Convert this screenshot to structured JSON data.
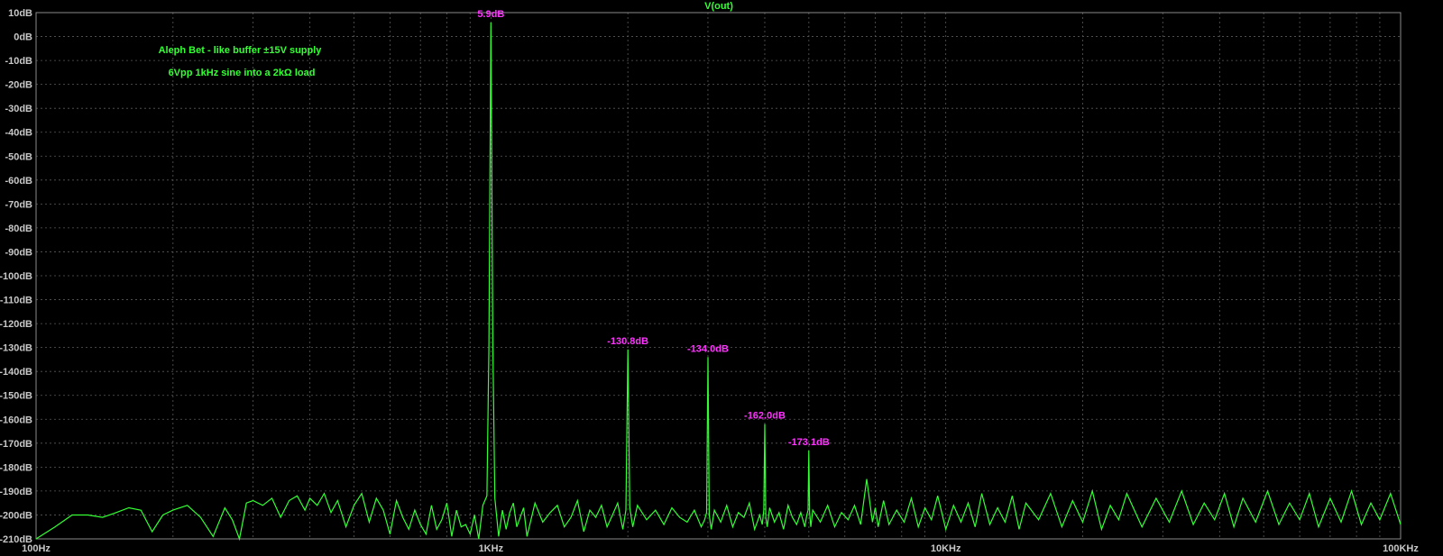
{
  "trace_color": "#33ff33",
  "label_color": "#ff33ff",
  "grid_color": "#5a5a5a",
  "chart_data": {
    "type": "line",
    "title": "V(out)",
    "annotations": [
      "Aleph Bet - like buffer ±15V supply",
      "6Vpp 1kHz sine into a 2kΩ load"
    ],
    "x_scale": "log",
    "xlim": [
      100,
      100000
    ],
    "ylim": [
      -210,
      10
    ],
    "grid": true,
    "xticks": [
      {
        "value": 100,
        "label": "100Hz"
      },
      {
        "value": 1000,
        "label": "1KHz"
      },
      {
        "value": 10000,
        "label": "10KHz"
      },
      {
        "value": 100000,
        "label": "100KHz"
      }
    ],
    "yticks": [
      {
        "value": 10,
        "label": "10dB"
      },
      {
        "value": 0,
        "label": "0dB"
      },
      {
        "value": -10,
        "label": "-10dB"
      },
      {
        "value": -20,
        "label": "-20dB"
      },
      {
        "value": -30,
        "label": "-30dB"
      },
      {
        "value": -40,
        "label": "-40dB"
      },
      {
        "value": -50,
        "label": "-50dB"
      },
      {
        "value": -60,
        "label": "-60dB"
      },
      {
        "value": -70,
        "label": "-70dB"
      },
      {
        "value": -80,
        "label": "-80dB"
      },
      {
        "value": -90,
        "label": "-90dB"
      },
      {
        "value": -100,
        "label": "-100dB"
      },
      {
        "value": -110,
        "label": "-110dB"
      },
      {
        "value": -120,
        "label": "-120dB"
      },
      {
        "value": -130,
        "label": "-130dB"
      },
      {
        "value": -140,
        "label": "-140dB"
      },
      {
        "value": -150,
        "label": "-150dB"
      },
      {
        "value": -160,
        "label": "-160dB"
      },
      {
        "value": -170,
        "label": "-170dB"
      },
      {
        "value": -180,
        "label": "-180dB"
      },
      {
        "value": -190,
        "label": "-190dB"
      },
      {
        "value": -200,
        "label": "-200dB"
      },
      {
        "value": -210,
        "label": "-210dB"
      }
    ],
    "peaks": [
      {
        "freq": 1000,
        "value": 5.9,
        "label": "5.9dB"
      },
      {
        "freq": 2000,
        "value": -130.8,
        "label": "-130.8dB"
      },
      {
        "freq": 3000,
        "value": -134.0,
        "label": "-134.0dB"
      },
      {
        "freq": 4000,
        "value": -162.0,
        "label": "-162.0dB"
      },
      {
        "freq": 5000,
        "value": -173.1,
        "label": "-173.1dB"
      }
    ],
    "series": [
      {
        "x": [
          100,
          110,
          120,
          130,
          140,
          150,
          160,
          170,
          180,
          190,
          200,
          215,
          230,
          245,
          260,
          270,
          280,
          290,
          300,
          315,
          330,
          345,
          360,
          375,
          390,
          400,
          415,
          430,
          445,
          460,
          480,
          500,
          520,
          540,
          560,
          580,
          600,
          620,
          640,
          660,
          680,
          700,
          720,
          740,
          760,
          780,
          800,
          820,
          840,
          860,
          880,
          900,
          920,
          940,
          960,
          980,
          990,
          1000,
          1010,
          1020,
          1040,
          1060,
          1080,
          1100,
          1120,
          1140,
          1160,
          1180,
          1200,
          1250,
          1300,
          1350,
          1400,
          1450,
          1500,
          1550,
          1600,
          1650,
          1700,
          1750,
          1800,
          1850,
          1900,
          1950,
          1980,
          2000,
          2020,
          2050,
          2100,
          2200,
          2300,
          2400,
          2500,
          2600,
          2700,
          2800,
          2900,
          2950,
          2980,
          3000,
          3020,
          3050,
          3100,
          3200,
          3300,
          3400,
          3500,
          3600,
          3700,
          3800,
          3900,
          3950,
          3980,
          4000,
          4020,
          4050,
          4100,
          4200,
          4300,
          4400,
          4500,
          4600,
          4700,
          4800,
          4900,
          4950,
          4980,
          5000,
          5020,
          5050,
          5100,
          5300,
          5500,
          5700,
          5900,
          6100,
          6300,
          6500,
          6700,
          6900,
          7000,
          7100,
          7300,
          7500,
          7800,
          8100,
          8400,
          8700,
          9000,
          9300,
          9600,
          10000,
          10400,
          10800,
          11200,
          11600,
          12000,
          12500,
          13000,
          13500,
          14000,
          14500,
          15000,
          16000,
          17000,
          18000,
          19000,
          20000,
          21000,
          22000,
          23000,
          24000,
          25000,
          27000,
          29000,
          31000,
          33000,
          35000,
          37000,
          39000,
          41000,
          43000,
          45000,
          48000,
          51000,
          54000,
          57000,
          60000,
          63000,
          66000,
          70000,
          74000,
          78000,
          82000,
          86000,
          90000,
          95000,
          100000
        ],
        "y": [
          -210,
          -205,
          -200,
          -200,
          -201,
          -199,
          -197,
          -198,
          -207,
          -200,
          -198,
          -196,
          -201,
          -209,
          -197,
          -202,
          -210,
          -195,
          -194,
          -196,
          -193,
          -201,
          -194,
          -192,
          -198,
          -193,
          -196,
          -191,
          -199,
          -194,
          -205,
          -196,
          -191,
          -203,
          -193,
          -198,
          -208,
          -194,
          -201,
          -206,
          -198,
          -204,
          -208,
          -196,
          -206,
          -202,
          -195,
          -209,
          -198,
          -205,
          -204,
          -208,
          -200,
          -210,
          -196,
          -192,
          -130,
          5.9,
          -130,
          -193,
          -209,
          -198,
          -206,
          -199,
          -195,
          -205,
          -201,
          -197,
          -209,
          -195,
          -203,
          -199,
          -196,
          -205,
          -201,
          -194,
          -207,
          -198,
          -201,
          -196,
          -205,
          -200,
          -195,
          -206,
          -198,
          -130.8,
          -197,
          -205,
          -196,
          -202,
          -198,
          -204,
          -197,
          -201,
          -203,
          -198,
          -205,
          -202,
          -199,
          -134.0,
          -200,
          -206,
          -198,
          -203,
          -196,
          -205,
          -199,
          -201,
          -195,
          -206,
          -200,
          -204,
          -198,
          -162.0,
          -201,
          -205,
          -197,
          -203,
          -199,
          -206,
          -196,
          -201,
          -204,
          -199,
          -205,
          -200,
          -198,
          -173.1,
          -199,
          -205,
          -198,
          -203,
          -196,
          -205,
          -199,
          -202,
          -196,
          -204,
          -185,
          -203,
          -197,
          -205,
          -194,
          -204,
          -198,
          -203,
          -193,
          -205,
          -197,
          -202,
          -192,
          -206,
          -196,
          -203,
          -195,
          -205,
          -191,
          -204,
          -197,
          -203,
          -192,
          -206,
          -195,
          -202,
          -191,
          -205,
          -194,
          -203,
          -190,
          -206,
          -196,
          -202,
          -191,
          -205,
          -193,
          -203,
          -190,
          -204,
          -195,
          -202,
          -191,
          -205,
          -193,
          -203,
          -190,
          -204,
          -195,
          -202,
          -191,
          -205,
          -193,
          -203,
          -190,
          -204,
          -195,
          -202,
          -191,
          -204
        ]
      }
    ]
  }
}
